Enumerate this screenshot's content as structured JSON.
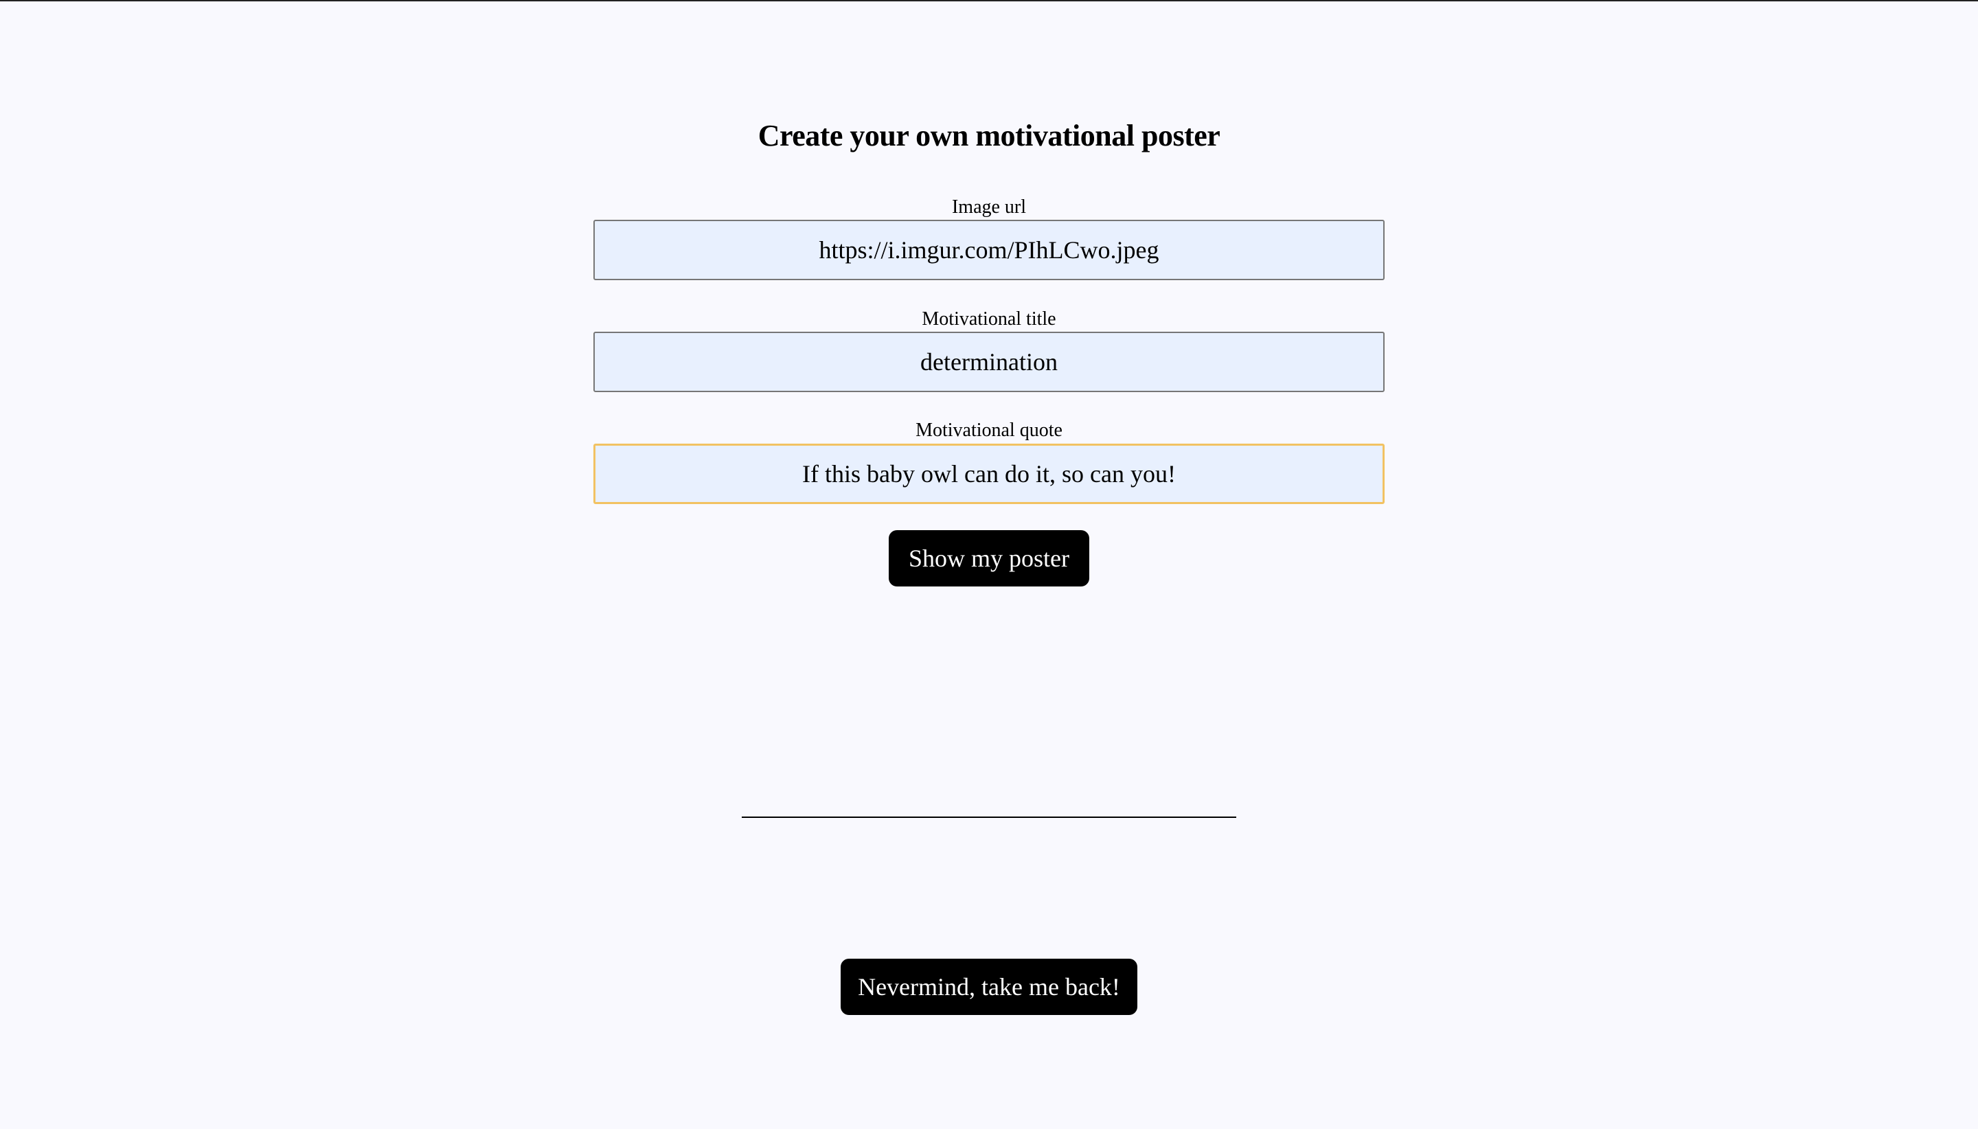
{
  "page": {
    "title": "Create your own motivational poster"
  },
  "form": {
    "image_url": {
      "label": "Image url",
      "value": "https://i.imgur.com/PIhLCwo.jpeg"
    },
    "motivational_title": {
      "label": "Motivational title",
      "value": "determination"
    },
    "motivational_quote": {
      "label": "Motivational quote",
      "value": "If this baby owl can do it, so can you!"
    },
    "submit_label": "Show my poster"
  },
  "navigation": {
    "back_label": "Nevermind, take me back!"
  },
  "colors": {
    "background": "#f9f9fe",
    "input_background": "#e8f0fe",
    "focus_border": "#f2c262",
    "button_background": "#000000",
    "button_text": "#ffffff"
  }
}
